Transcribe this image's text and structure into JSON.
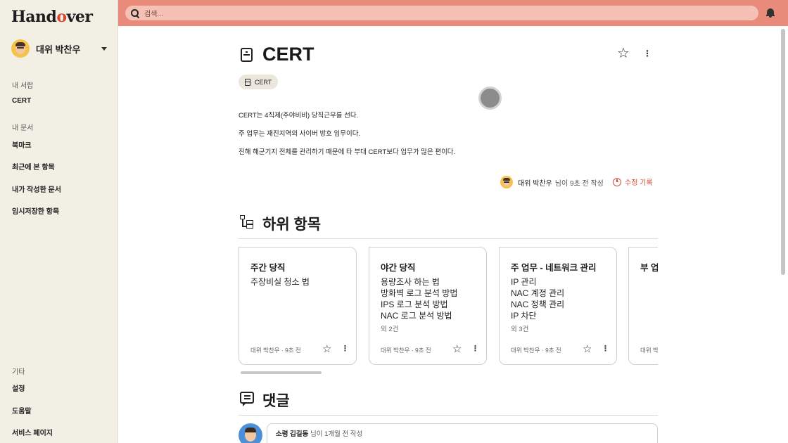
{
  "app": {
    "logo": "Handover"
  },
  "user": {
    "name": "대위 박찬우"
  },
  "sidebar": {
    "shelf_header": "내 서랍",
    "shelf_items": [
      {
        "label": "CERT"
      }
    ],
    "docs_header": "내 문서",
    "doc_items": [
      {
        "label": "북마크"
      },
      {
        "label": "최근에 본 항목"
      },
      {
        "label": "내가 작성한 문서"
      },
      {
        "label": "임시저장한 항목"
      }
    ],
    "etc_header": "기타",
    "etc_items": [
      {
        "label": "설정"
      },
      {
        "label": "도움말"
      },
      {
        "label": "서비스 페이지"
      }
    ]
  },
  "search": {
    "placeholder": "검색..."
  },
  "document": {
    "title": "CERT",
    "tag": "CERT",
    "paragraphs": [
      "CERT는 4직제(주야비비) 당직근무를 선다.",
      "주 업무는 재진지역의 사이버 방호 임무이다.",
      "진해 해군기지 전체를 관리하기 때문에 타 부대 CERT보다 업무가 많은 편이다."
    ],
    "author": "대위 박찬우",
    "author_suffix": "님이 9초 전 작성",
    "history_label": "수정 기록"
  },
  "subitems": {
    "heading": "하위 항목",
    "cards": [
      {
        "title": "주간 당직",
        "items": [
          "주장비실 청소 법"
        ],
        "more": "",
        "meta": "대위 박찬우 · 9초 전"
      },
      {
        "title": "야간 당직",
        "items": [
          "용량조사 하는 법",
          "방화벽 로그 분석 방법",
          "IPS 로그 분석 방법",
          "NAC 로그 분석 방법"
        ],
        "more": "외 2건",
        "meta": "대위 박찬우 · 9초 전"
      },
      {
        "title": "주 업무 - 네트워크 관리",
        "items": [
          "IP 관리",
          "NAC 계정 관리",
          "NAC 정책 관리",
          "IP 차단"
        ],
        "more": "외 3건",
        "meta": "대위 박찬우 · 9초 전"
      },
      {
        "title": "부 업무",
        "items": [],
        "more": "",
        "meta": "대위 박찬우"
      }
    ]
  },
  "comments": {
    "heading": "댓글",
    "items": [
      {
        "author": "소령 김길동",
        "suffix": "님이 1개월 전 작성"
      }
    ]
  },
  "icons": {
    "star": "☆",
    "more": "⋮"
  }
}
